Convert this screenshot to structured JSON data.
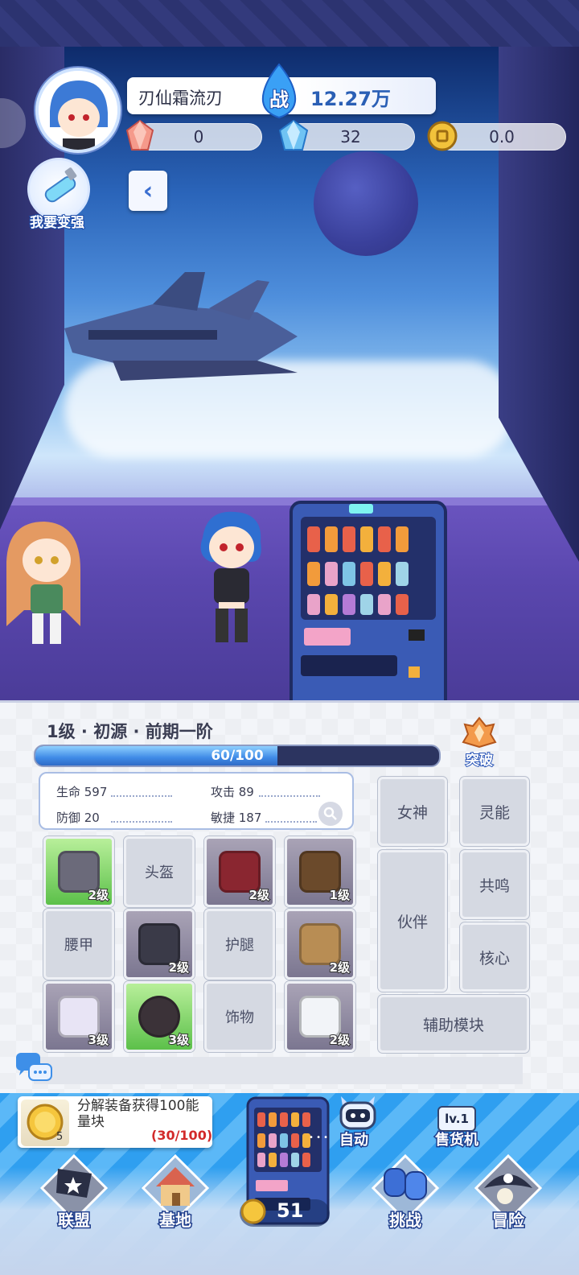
{
  "hud": {
    "player_name": "刃仙霜流刃",
    "power_icon_text": "战",
    "power_value": "12.27万",
    "currency": [
      {
        "icon": "pink-crystal-icon",
        "value": "0"
      },
      {
        "icon": "blue-diamond-icon",
        "value": "32"
      },
      {
        "icon": "gold-coin-icon",
        "value": "0.0"
      }
    ],
    "stronger_label": "我要变强",
    "back_icon": "‹"
  },
  "character": {
    "level_title": "1级 · 初源 · 前期一阶",
    "breakthrough_label": "突破",
    "exp_text": "60/100",
    "exp_fraction": 0.6,
    "stats": {
      "hp": "生命 597",
      "atk": "攻击 89",
      "def": "防御 20",
      "agi": "敏捷 187"
    }
  },
  "equipment": [
    {
      "name": "pistol",
      "label": "",
      "level": "2级",
      "style": "green"
    },
    {
      "name": "helmet",
      "label": "头盔",
      "level": "",
      "style": "empty"
    },
    {
      "name": "jacket",
      "label": "",
      "level": "2级",
      "style": "item"
    },
    {
      "name": "boots",
      "label": "",
      "level": "1级",
      "style": "item"
    },
    {
      "name": "belt",
      "label": "腰甲",
      "level": "",
      "style": "empty"
    },
    {
      "name": "glove",
      "label": "",
      "level": "2级",
      "style": "item"
    },
    {
      "name": "legguard",
      "label": "护腿",
      "level": "",
      "style": "empty"
    },
    {
      "name": "shorts",
      "label": "",
      "level": "2级",
      "style": "item"
    },
    {
      "name": "wing",
      "label": "",
      "level": "3级",
      "style": "item"
    },
    {
      "name": "ring",
      "label": "",
      "level": "3级",
      "style": "green"
    },
    {
      "name": "accessory",
      "label": "饰物",
      "level": "",
      "style": "empty"
    },
    {
      "name": "uniform",
      "label": "",
      "level": "2级",
      "style": "item"
    }
  ],
  "side_buttons": {
    "goddess": "女神",
    "psionic": "灵能",
    "partner": "伙伴",
    "resonance": "共鸣",
    "core": "核心",
    "aux_module": "辅助模块"
  },
  "quest": {
    "text": "分解装备获得100能量块",
    "progress": "(30/100)",
    "coin_count": "5"
  },
  "nav": {
    "alliance": "联盟",
    "base": "基地",
    "challenge": "挑战",
    "adventure": "冒险",
    "auto": "自动",
    "vending": "售货机",
    "vending_level": "lv.1",
    "coins": "51"
  }
}
